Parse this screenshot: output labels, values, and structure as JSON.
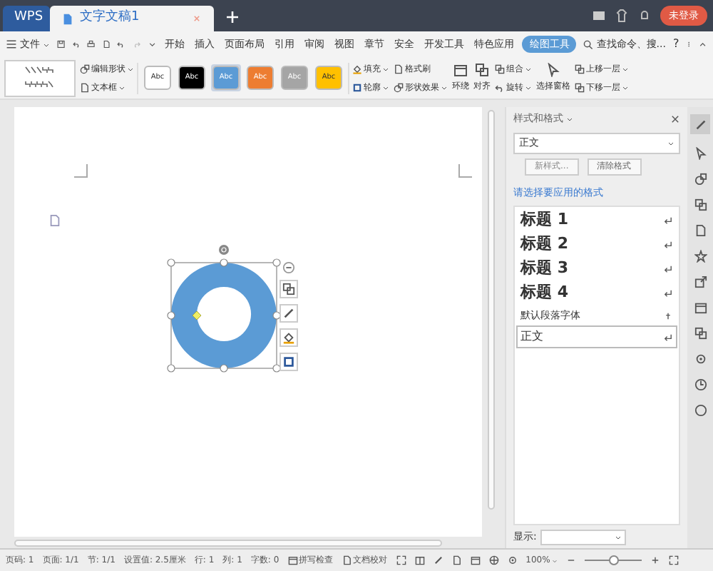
{
  "tabs": [
    {
      "label": "WPS",
      "kind": "app",
      "selected": false
    },
    {
      "label": "文字文稿1",
      "kind": "doc",
      "selected": true
    }
  ],
  "account": {
    "label": "未登录"
  },
  "menu": {
    "file": "文件",
    "items": [
      {
        "label": "开始",
        "selected": false
      },
      {
        "label": "插入",
        "selected": false
      },
      {
        "label": "页面布局",
        "selected": false
      },
      {
        "label": "引用",
        "selected": false
      },
      {
        "label": "审阅",
        "selected": false
      },
      {
        "label": "视图",
        "selected": false
      },
      {
        "label": "章节",
        "selected": false
      },
      {
        "label": "安全",
        "selected": false
      },
      {
        "label": "开发工具",
        "selected": false
      },
      {
        "label": "特色应用",
        "selected": false
      },
      {
        "label": "绘图工具",
        "selected": true
      }
    ],
    "search": "查找命令、搜...",
    "help": "?"
  },
  "toolbar": {
    "edit_shape": "编辑形状",
    "text_box": "文本框",
    "swatches": [
      {
        "label": "Abc",
        "color": "#ffffff",
        "selected": false
      },
      {
        "label": "Abc",
        "color": "#000000",
        "selected": false
      },
      {
        "label": "Abc",
        "color": "#5b9bd5",
        "selected": true
      },
      {
        "label": "Abc",
        "color": "#ed7d31",
        "selected": false
      },
      {
        "label": "Abc",
        "color": "#a5a5a5",
        "selected": false
      },
      {
        "label": "Abc",
        "color": "#ffc000",
        "selected": false
      }
    ],
    "fill": "填充",
    "outline": "轮廓",
    "format_painter": "格式刷",
    "shape_effects": "形状效果",
    "wrap": "环绕",
    "align": "对齐",
    "group": "组合",
    "rotate": "旋转",
    "selection_pane": "选择窗格",
    "bring_forward": "上移一层",
    "send_backward": "下移一层"
  },
  "panel": {
    "title": "样式和格式",
    "current_style": "正文",
    "new_style": "新样式...",
    "clear_format": "清除格式",
    "prompt": "请选择要应用的格式",
    "styles": [
      {
        "label": "标题 1",
        "kind": "heading",
        "selected": false
      },
      {
        "label": "标题 2",
        "kind": "heading",
        "selected": false
      },
      {
        "label": "标题 3",
        "kind": "heading",
        "selected": false
      },
      {
        "label": "标题 4",
        "kind": "heading",
        "selected": false
      },
      {
        "label": "默认段落字体",
        "kind": "char",
        "selected": false
      },
      {
        "label": "正文",
        "kind": "para",
        "selected": true
      }
    ],
    "show_label": "显示:"
  },
  "status": {
    "items": [
      "页码: 1",
      "页面: 1/1",
      "节: 1/1",
      "设置值: 2.5厘米",
      "行: 1",
      "列: 1",
      "字数: 0"
    ],
    "spell": "拼写检查",
    "proof": "文档校对",
    "zoom": "100%",
    "zoom_level": {
      "level": 0.5
    }
  }
}
